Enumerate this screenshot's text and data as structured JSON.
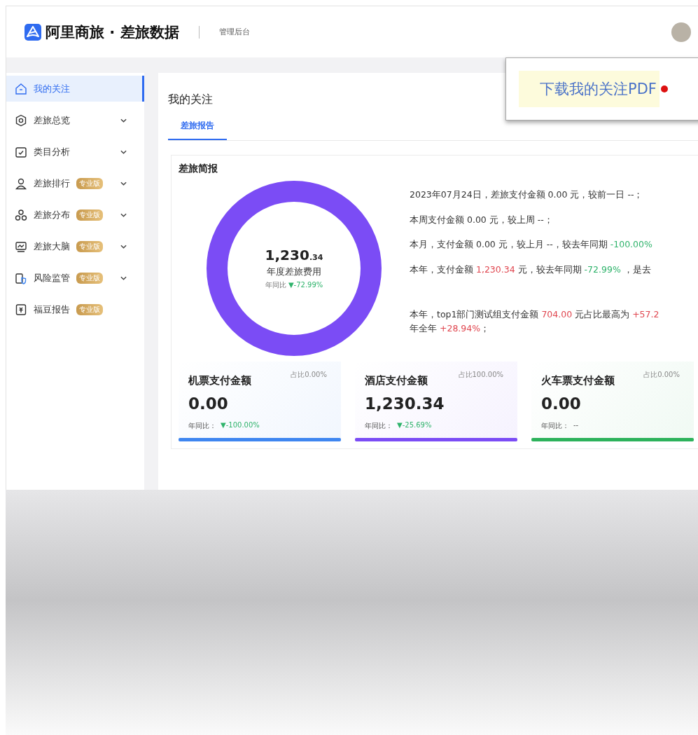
{
  "header": {
    "brand": "阿里商旅 · 差旅数据",
    "subtitle": "管理后台"
  },
  "sidebar": {
    "items": [
      {
        "label": "我的关注",
        "selected": true,
        "expandable": false
      },
      {
        "label": "差旅总览",
        "selected": false,
        "expandable": true
      },
      {
        "label": "类目分析",
        "selected": false,
        "expandable": true
      },
      {
        "label": "差旅排行",
        "selected": false,
        "expandable": true,
        "badge": "专业版"
      },
      {
        "label": "差旅分布",
        "selected": false,
        "expandable": true,
        "badge": "专业版"
      },
      {
        "label": "差旅大脑",
        "selected": false,
        "expandable": true,
        "badge": "专业版"
      },
      {
        "label": "风险监管",
        "selected": false,
        "expandable": true,
        "badge": "专业版"
      },
      {
        "label": "福豆报告",
        "selected": false,
        "expandable": false,
        "badge": "专业版"
      }
    ]
  },
  "popup": {
    "label": "下载我的关注PDF"
  },
  "page": {
    "title": "我的关注",
    "tabs": [
      {
        "label": "差旅报告",
        "selected": true
      }
    ]
  },
  "brief": {
    "title": "差旅简报",
    "ring": {
      "amount_main": "1,230",
      "amount_fraction": ".34",
      "label": "年度差旅费用",
      "yoy_label": "年同比",
      "yoy_value": "▼-72.99%"
    },
    "statements": [
      [
        {
          "text": "2023年07月24日，差旅支付金额 0.00 元，较前一日 --；",
          "kind": "plain"
        }
      ],
      [
        {
          "text": "本周支付金额 0.00 元，较上周 --；",
          "kind": "plain"
        }
      ],
      [
        {
          "text": "本月，支付金额 0.00 元，较上月 --，较去年同期 ",
          "kind": "plain"
        },
        {
          "text": "-100.00%",
          "kind": "down"
        }
      ],
      [
        {
          "text": "本年，支付金额 ",
          "kind": "plain"
        },
        {
          "text": "1,230.34",
          "kind": "up"
        },
        {
          "text": " 元，较去年同期 ",
          "kind": "plain"
        },
        {
          "text": "-72.99%",
          "kind": "down"
        },
        {
          "text": " ，是去",
          "kind": "plain"
        }
      ]
    ],
    "summary": [
      [
        {
          "text": "本年，top1部门测试组支付金额 ",
          "kind": "plain"
        },
        {
          "text": "704.00",
          "kind": "up"
        },
        {
          "text": " 元占比最高为 ",
          "kind": "plain"
        },
        {
          "text": "+57.2",
          "kind": "up"
        }
      ],
      [
        {
          "text": "年全年 ",
          "kind": "plain"
        },
        {
          "text": "+28.94%",
          "kind": "up"
        },
        {
          "text": "；",
          "kind": "plain"
        }
      ]
    ]
  },
  "stat_cards": [
    {
      "title": "机票支付金额",
      "share": "占比0.00%",
      "amount": "0.00",
      "yoy_label": "年同比：",
      "yoy_value": "▼-100.00%",
      "kind": "down",
      "color": "#3f86f0"
    },
    {
      "title": "酒店支付金额",
      "share": "占比100.00%",
      "amount": "1,230.34",
      "yoy_label": "年同比：",
      "yoy_value": "▼-25.69%",
      "kind": "down",
      "color": "#7b4cf5"
    },
    {
      "title": "火车票支付金额",
      "share": "占比0.00%",
      "amount": "0.00",
      "yoy_label": "年同比：",
      "yoy_value": "--",
      "kind": "plain",
      "color": "#2db25b"
    }
  ]
}
